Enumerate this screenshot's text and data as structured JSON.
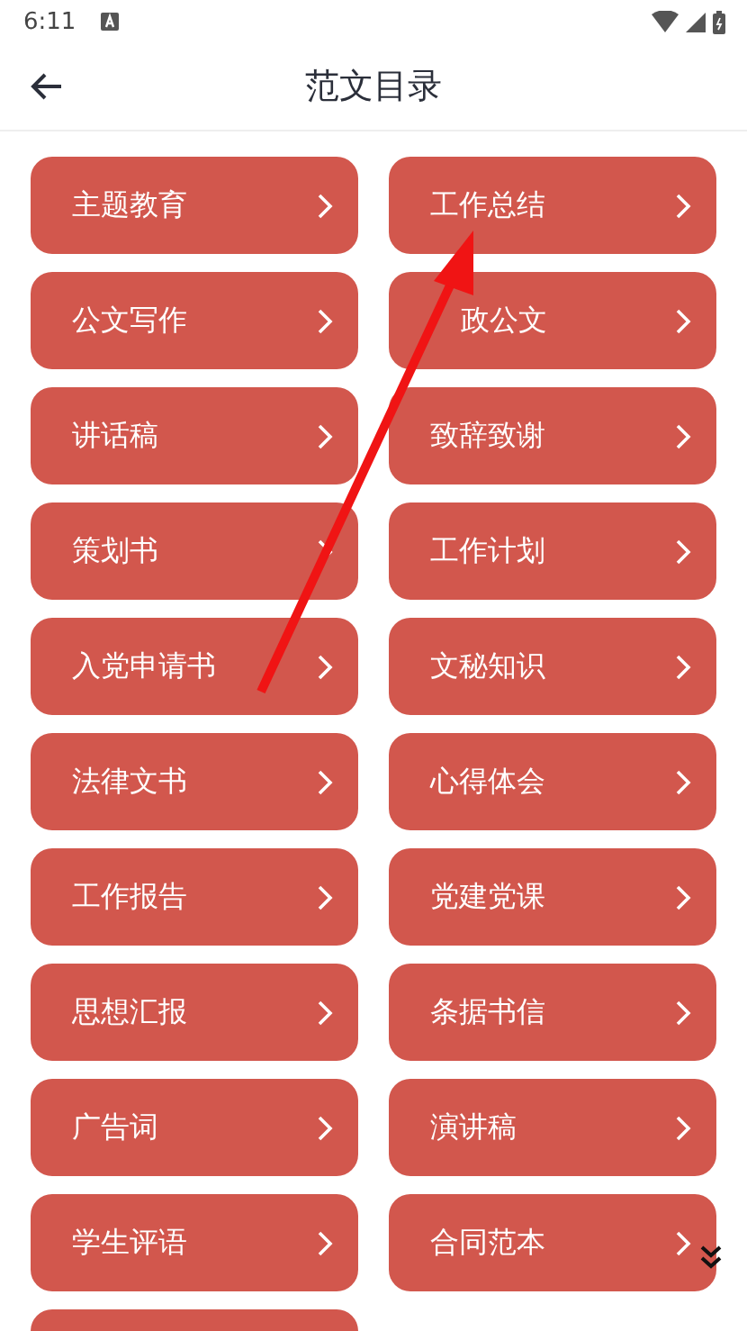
{
  "status_bar": {
    "time": "6:11"
  },
  "app_bar": {
    "title": "范文目录"
  },
  "categories": [
    {
      "label": "主题教育"
    },
    {
      "label": "工作总结"
    },
    {
      "label": "公文写作"
    },
    {
      "label": "政公文",
      "covered_start": true
    },
    {
      "label": "讲话稿"
    },
    {
      "label": "致辞致谢"
    },
    {
      "label": "策划书"
    },
    {
      "label": "工作计划"
    },
    {
      "label": "入党申请书"
    },
    {
      "label": "文秘知识"
    },
    {
      "label": "法律文书"
    },
    {
      "label": "心得体会"
    },
    {
      "label": "工作报告"
    },
    {
      "label": "党建党课"
    },
    {
      "label": "思想汇报"
    },
    {
      "label": "条据书信"
    },
    {
      "label": "广告词"
    },
    {
      "label": "演讲稿"
    },
    {
      "label": "学生评语"
    },
    {
      "label": "合同范本"
    }
  ],
  "more_below": true
}
